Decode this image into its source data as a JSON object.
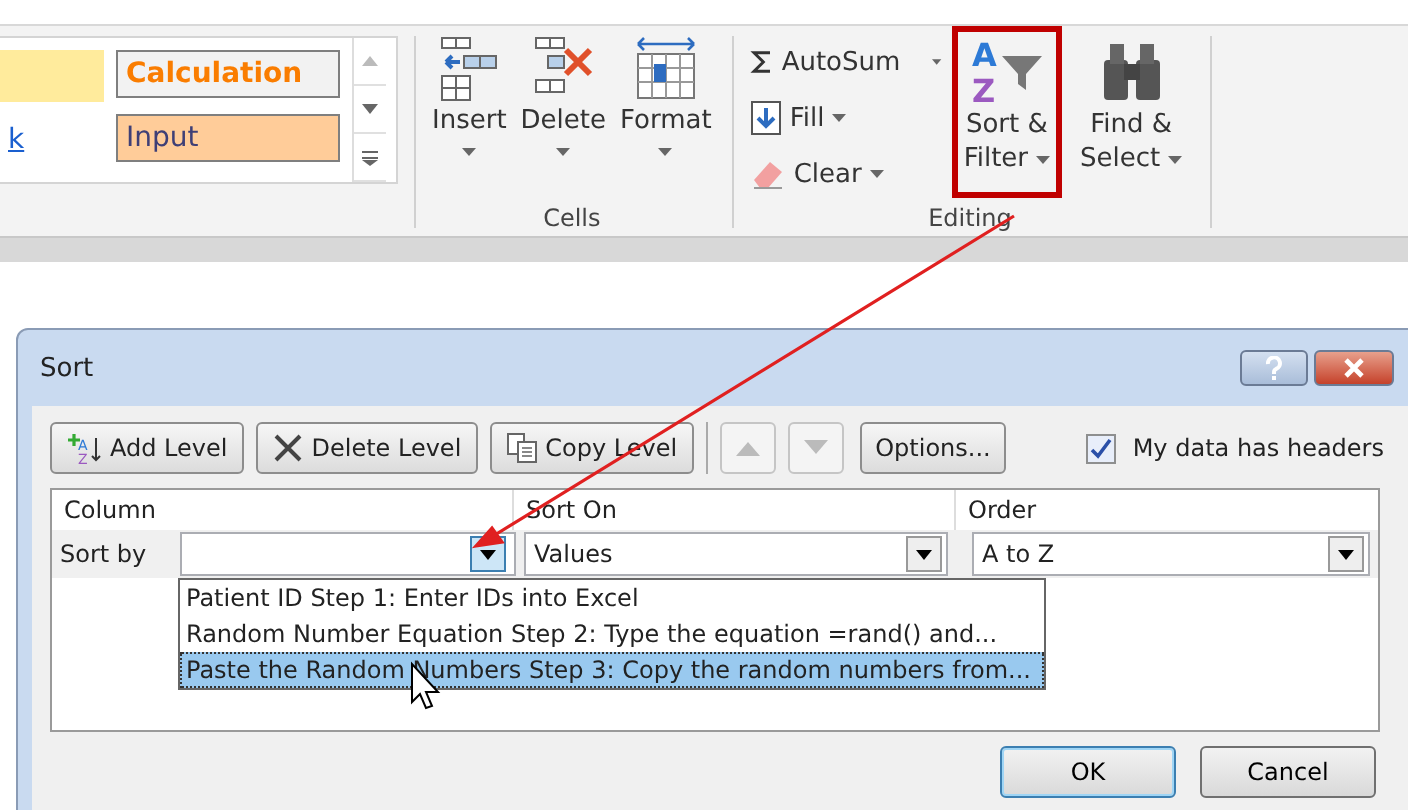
{
  "ribbon": {
    "style_gallery": {
      "link_text": "k",
      "cells": [
        {
          "label": "Calculation",
          "kind": "calculation"
        },
        {
          "label": "Input",
          "kind": "input"
        }
      ]
    },
    "cells_group": {
      "label": "Cells",
      "buttons": [
        {
          "label": "Insert",
          "kind": "insert"
        },
        {
          "label": "Delete",
          "kind": "delete"
        },
        {
          "label": "Format",
          "kind": "format"
        }
      ]
    },
    "editing_group": {
      "label": "Editing",
      "small_buttons": [
        {
          "label": "AutoSum",
          "kind": "autosum"
        },
        {
          "label": "Fill",
          "kind": "fill"
        },
        {
          "label": "Clear",
          "kind": "clear"
        }
      ],
      "big_buttons": [
        {
          "line1": "Sort &",
          "line2": "Filter",
          "kind": "sort",
          "icon_letters": [
            "A",
            "Z"
          ],
          "highlighted": true
        },
        {
          "line1": "Find &",
          "line2": "Select",
          "kind": "find",
          "highlighted": false
        }
      ]
    }
  },
  "dialog": {
    "title": "Sort",
    "toolbar": [
      {
        "label": "Add Level",
        "kind": "add",
        "icon_letters": [
          "A",
          "Z"
        ]
      },
      {
        "label": "Delete Level",
        "kind": "delete"
      },
      {
        "label": "Copy Level",
        "kind": "copy"
      }
    ],
    "move_buttons": [
      {
        "kind": "up",
        "disabled": true
      },
      {
        "kind": "down",
        "disabled": true
      }
    ],
    "options_button": "Options...",
    "headers_checkbox": {
      "label": "My data has headers",
      "checked": true
    },
    "columns": [
      "Column",
      "Sort On",
      "Order"
    ],
    "row": {
      "label": "Sort by",
      "sort_on": "Values",
      "order": "A to Z"
    },
    "column_list": [
      {
        "label": "Patient ID Step 1: Enter IDs into Excel",
        "selected": false
      },
      {
        "label": "Random Number Equation Step 2:  Type the equation =rand() and...",
        "selected": false
      },
      {
        "label": "Paste the Random Numbers Step 3: Copy the random numbers from...",
        "selected": true
      }
    ],
    "buttons": [
      {
        "label": "OK",
        "default": true
      },
      {
        "label": "Cancel",
        "default": false
      }
    ]
  }
}
